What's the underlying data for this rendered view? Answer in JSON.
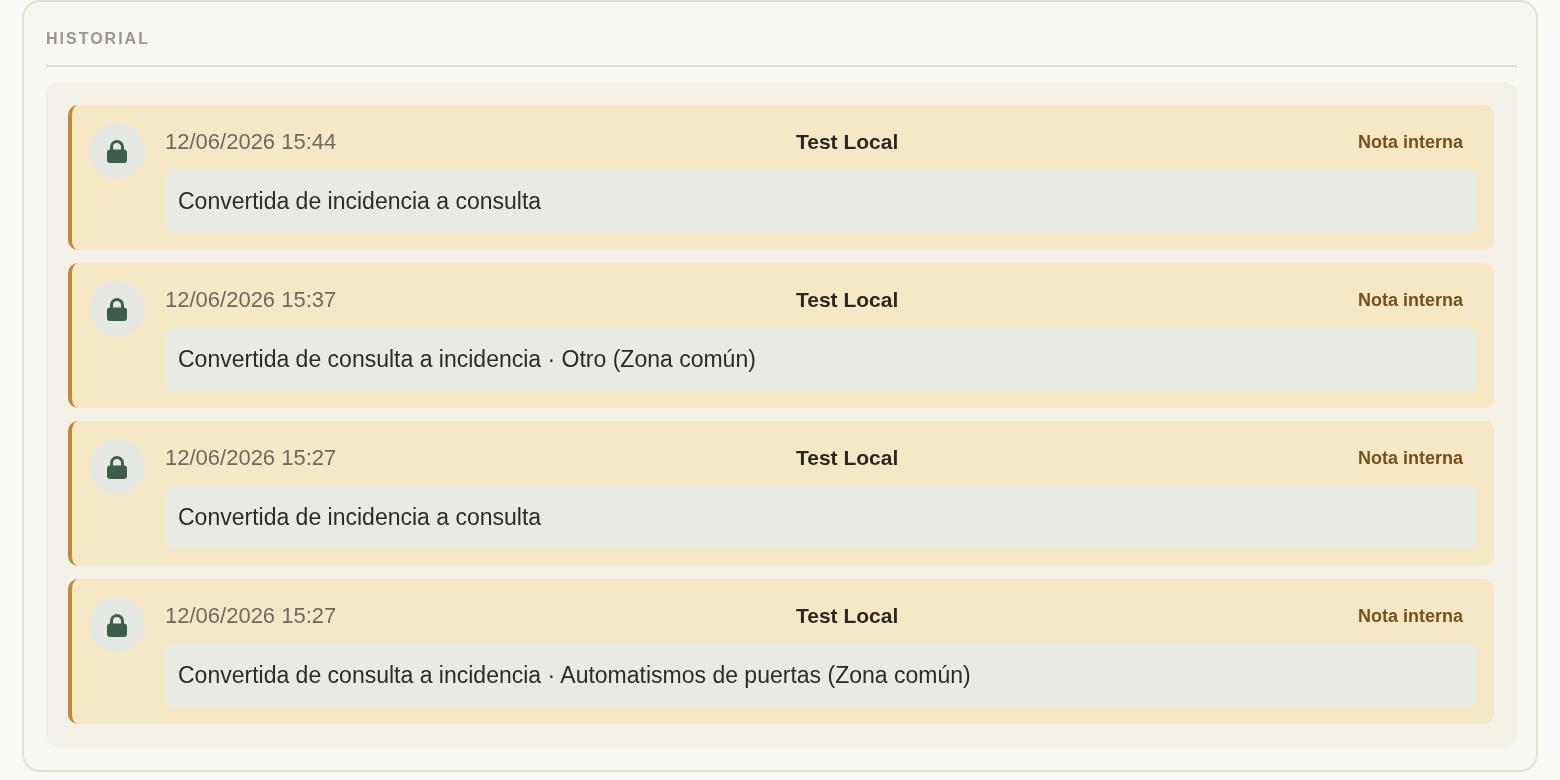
{
  "section": {
    "title": "HISTORIAL"
  },
  "entries": [
    {
      "kind": "internal",
      "timestamp": "12/06/2026 15:44",
      "author": "Test Local",
      "tag": "Nota interna",
      "message": "Convertida de incidencia a consulta"
    },
    {
      "kind": "internal",
      "timestamp": "12/06/2026 15:37",
      "author": "Test Local",
      "tag": "Nota interna",
      "message": "Convertida de consulta a incidencia · Otro (Zona común)"
    },
    {
      "kind": "internal",
      "timestamp": "12/06/2026 15:27",
      "author": "Test Local",
      "tag": "Nota interna",
      "message": "Convertida de incidencia a consulta"
    },
    {
      "kind": "internal",
      "timestamp": "12/06/2026 15:27",
      "author": "Test Local",
      "tag": "Nota interna",
      "message": "Convertida de consulta a incidencia · Automatismos de puertas (Zona común)"
    }
  ]
}
